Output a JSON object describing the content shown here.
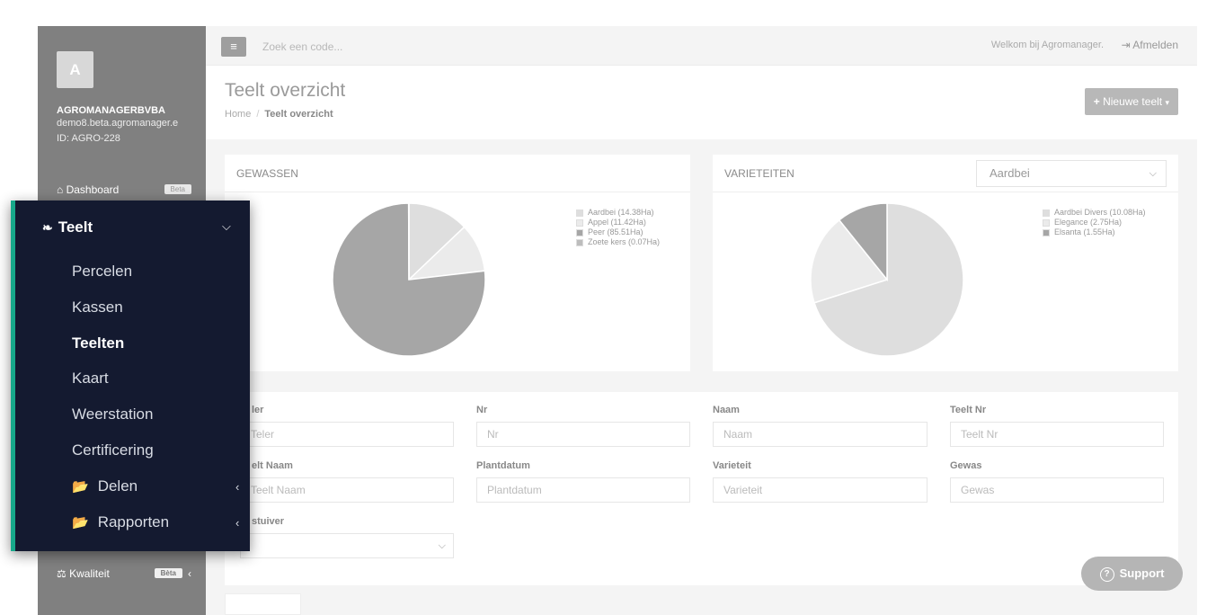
{
  "sidebar": {
    "avatar_letter": "A",
    "company": "AGROMANAGERBVBA",
    "domain": "demo8.beta.agromanager.e",
    "account_id": "ID: AGRO-228",
    "dashboard_label": "Dashboard",
    "dashboard_badge": "Beta",
    "kwaliteit_label": "Kwaliteit",
    "kwaliteit_badge": "Bèta"
  },
  "submenu": {
    "title": "Teelt",
    "items": [
      {
        "label": "Percelen"
      },
      {
        "label": "Kassen"
      },
      {
        "label": "Teelten"
      },
      {
        "label": "Kaart"
      },
      {
        "label": "Weerstation"
      },
      {
        "label": "Certificering"
      },
      {
        "label": "Delen"
      },
      {
        "label": "Rapporten"
      }
    ],
    "active_item": "Teelten"
  },
  "topbar": {
    "search_placeholder": "Zoek een code...",
    "welcome": "Welkom bij Agromanager.",
    "logout": "Afmelden"
  },
  "header": {
    "title": "Teelt overzicht",
    "breadcrumb_home": "Home",
    "breadcrumb_current": "Teelt overzicht",
    "new_button": "Nieuwe teelt"
  },
  "gewassen": {
    "title": "GEWASSEN",
    "legend": [
      {
        "label": "Aardbei (14.38Ha)",
        "color": "#dedede"
      },
      {
        "label": "Appel (11.42Ha)",
        "color": "#ebebeb"
      },
      {
        "label": "Peer (85.51Ha)",
        "color": "#a6a6a6"
      },
      {
        "label": "Zoete kers (0.07Ha)",
        "color": "#bdbdbd"
      }
    ]
  },
  "varieteiten": {
    "title": "VARIETEITEN",
    "selected": "Aardbei",
    "legend": [
      {
        "label": "Aardbei Divers (10.08Ha)",
        "color": "#dedede"
      },
      {
        "label": "Elegance (2.75Ha)",
        "color": "#ebebeb"
      },
      {
        "label": "Elsanta (1.55Ha)",
        "color": "#a6a6a6"
      }
    ]
  },
  "chart_data": [
    {
      "type": "pie",
      "title": "GEWASSEN",
      "categories": [
        "Aardbei",
        "Appel",
        "Peer",
        "Zoete kers"
      ],
      "values": [
        14.38,
        11.42,
        85.51,
        0.07
      ],
      "colors": [
        "#dedede",
        "#ebebeb",
        "#a6a6a6",
        "#bdbdbd"
      ]
    },
    {
      "type": "pie",
      "title": "VARIETEITEN",
      "categories": [
        "Aardbei Divers",
        "Elegance",
        "Elsanta"
      ],
      "values": [
        10.08,
        2.75,
        1.55
      ],
      "colors": [
        "#dedede",
        "#ebebeb",
        "#a6a6a6"
      ]
    }
  ],
  "filters": {
    "teler_label": "ler",
    "teler_placeholder": "Teler",
    "nr_label": "Nr",
    "nr_placeholder": "Nr",
    "naam_label": "Naam",
    "naam_placeholder": "Naam",
    "teeltnr_label": "Teelt Nr",
    "teeltnr_placeholder": "Teelt Nr",
    "teeltnaam_label": "elt Naam",
    "teeltnaam_placeholder": "Teelt Naam",
    "plantdatum_label": "Plantdatum",
    "plantdatum_placeholder": "Plantdatum",
    "varieteit_label": "Varieteit",
    "varieteit_placeholder": "Varieteit",
    "gewas_label": "Gewas",
    "gewas_placeholder": "Gewas",
    "bestuiver_label": "stuiver"
  },
  "support_label": "Support"
}
